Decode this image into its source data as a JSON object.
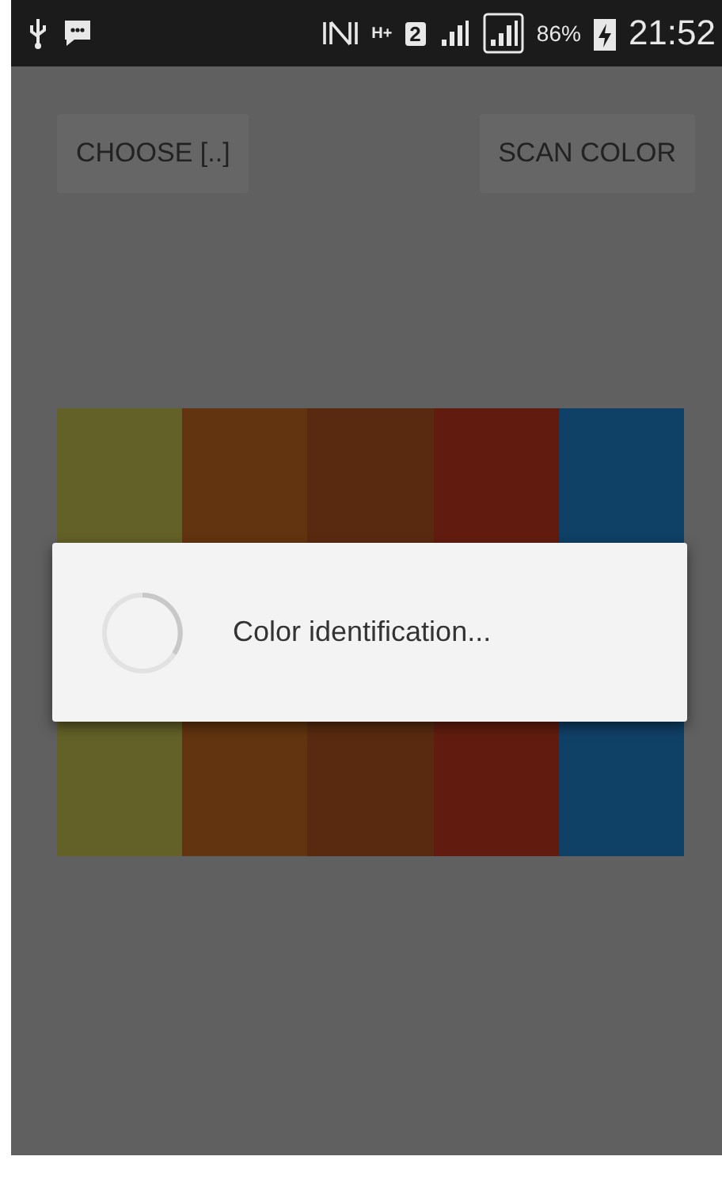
{
  "status_bar": {
    "network_type": "H+",
    "sim_slot": "2",
    "battery": "86%",
    "time": "21:52"
  },
  "buttons": [
    {
      "label": "CHOOSE [..]"
    },
    {
      "label": "SCAN COLOR"
    }
  ],
  "swatches": [
    {
      "color": "#636128"
    },
    {
      "color": "#62340f"
    },
    {
      "color": "#5a2a10"
    },
    {
      "color": "#621c0f"
    },
    {
      "color": "#0f4066"
    }
  ],
  "dialog": {
    "message": "Color identification..."
  }
}
